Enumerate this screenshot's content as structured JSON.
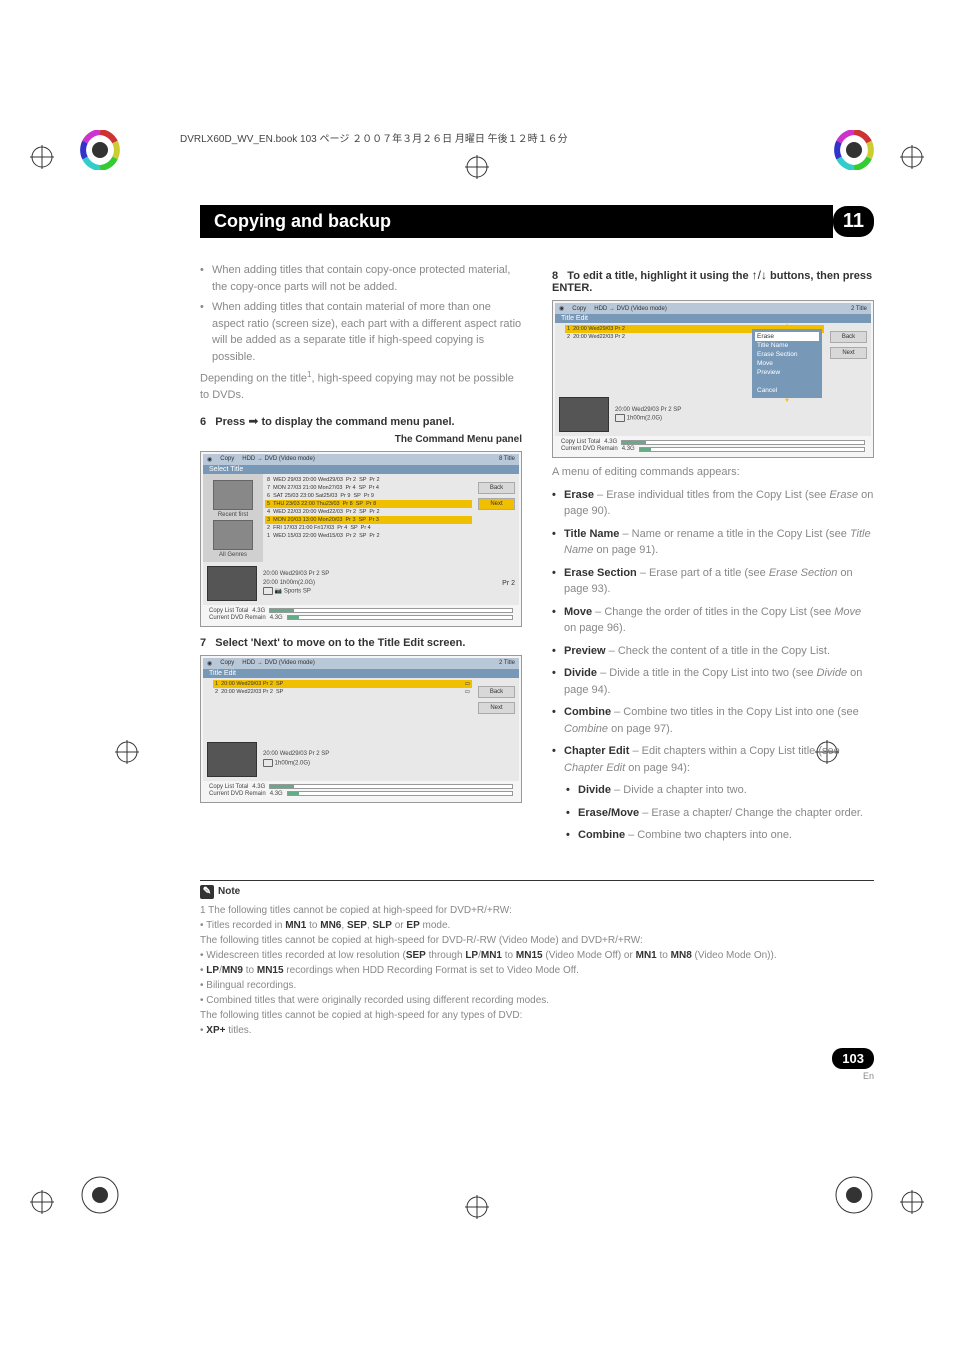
{
  "header_line": "DVRLX60D_WV_EN.book 103 ページ ２００７年３月２６日 月曜日 午後１２時１６分",
  "chapter": {
    "title": "Copying and backup",
    "number": "11"
  },
  "col1": {
    "bullets": [
      "When adding titles that contain copy-once protected material, the copy-once parts will not be added.",
      "When adding titles that contain material of more than one aspect ratio (screen size), each part with a different aspect ratio will be added as a separate title if high-speed copying is possible."
    ],
    "depend_text_a": "Depending on the title",
    "depend_sup": "1",
    "depend_text_b": ", high-speed copying may not be possible to DVDs.",
    "step6": {
      "num": "6",
      "act": "Press ",
      "arrow": "➡",
      "rest": " to display the command menu panel."
    },
    "panel_label": "The Command Menu panel",
    "step7": {
      "num": "7",
      "rest": "Select 'Next' to move on to the Title Edit screen."
    }
  },
  "col2": {
    "step8": {
      "num": "8",
      "rest_a": "To edit a title, highlight it using the ",
      "arrows": "↑/↓",
      "rest_b": " buttons, then press ENTER."
    },
    "menu_intro": "A menu of editing commands appears:",
    "features": [
      {
        "name": "Erase",
        "desc": " – Erase individual titles from the Copy List (see ",
        "ref": "Erase",
        "page": " on page 90)."
      },
      {
        "name": "Title Name",
        "desc": " – Name or rename a title in the Copy List (see ",
        "ref": "Title Name",
        "page": " on page 91)."
      },
      {
        "name": "Erase Section",
        "desc": " – Erase part of a title (see ",
        "ref": "Erase Section",
        "page": " on page 93)."
      },
      {
        "name": "Move",
        "desc": " – Change the order of titles in the Copy List (see ",
        "ref": "Move",
        "page": " on page 96)."
      },
      {
        "name": "Preview",
        "desc": " – Check the content of a title in the Copy List.",
        "ref": "",
        "page": ""
      },
      {
        "name": "Divide",
        "desc": " – Divide a title in the Copy List into two (see ",
        "ref": "Divide",
        "page": " on page 94)."
      },
      {
        "name": "Combine",
        "desc": " – Combine two titles in the Copy List into one (see ",
        "ref": "Combine",
        "page": " on page 97)."
      },
      {
        "name": "Chapter Edit",
        "desc": " – Edit chapters within a Copy List title (see ",
        "ref": "Chapter Edit",
        "page": " on page 94):"
      }
    ],
    "sub_features": [
      {
        "name": "Divide",
        "desc": " – Divide a chapter into two."
      },
      {
        "name": "Erase/Move",
        "desc": " – Erase a chapter/ Change the chapter order."
      },
      {
        "name": "Combine",
        "desc": " – Combine two chapters into one."
      }
    ]
  },
  "screenshots": {
    "common": {
      "copy_label": "Copy",
      "mode_label": "HDD → DVD (Video mode)",
      "back": "Back",
      "next": "Next",
      "copy_list_total": "Copy List Total",
      "current_dvd_remain": "Current DVD Remain",
      "val_43g_a": "4.3G",
      "val_43g_b": "4.3G"
    },
    "ss1": {
      "title_count": "8 Title",
      "tab": "Select Title",
      "left_recent": "Recent first",
      "left_genres": "All Genres",
      "rows": [
        {
          "n": "8",
          "d": "WED 29/03 20:00 Wed29/03",
          "p": "Pr 2",
          "m": "SP",
          "r": "Pr 2"
        },
        {
          "n": "7",
          "d": "MON 27/03 21:00 Mon27/03",
          "p": "Pr 4",
          "m": "SP",
          "r": "Pr 4"
        },
        {
          "n": "6",
          "d": "SAT 25/03 23:00 Sat25/03",
          "p": "Pr 9",
          "m": "SP",
          "r": "Pr 9"
        },
        {
          "n": "5",
          "d": "THU 23/03 22:00 Thu23/03",
          "p": "Pr 8",
          "m": "SP",
          "r": "Pr 8"
        },
        {
          "n": "4",
          "d": "WED 22/03 20:00 Wed22/03",
          "p": "Pr 2",
          "m": "SP",
          "r": "Pr 2"
        },
        {
          "n": "3",
          "d": "MON 20/03 13:00 Mon20/03",
          "p": "Pr 3",
          "m": "SP",
          "r": "Pr 3"
        },
        {
          "n": "2",
          "d": "FRI 17/03 21:00 Fri17/03",
          "p": "Pr 4",
          "m": "SP",
          "r": "Pr 4"
        },
        {
          "n": "1",
          "d": "WED 15/03 22:00 Wed15/03",
          "p": "Pr 2",
          "m": "SP",
          "r": "Pr 2"
        }
      ],
      "preview": {
        "time": "20:00",
        "date": "Wed29/03",
        "pr": "Pr 2",
        "mode": "SP",
        "dur": "1h00m(2.0G)",
        "time2": "20:00",
        "genre": "Sports",
        "mode2": "SP",
        "pr2": "Pr 2"
      }
    },
    "ss2": {
      "title_count": "2 Title",
      "tab": "Title Edit",
      "rows": [
        {
          "n": "1",
          "t": "20:00 Wed29/03 Pr 2",
          "m": "SP"
        },
        {
          "n": "2",
          "t": "20:00 Wed22/03 Pr 2",
          "m": "SP"
        }
      ],
      "preview": {
        "time": "20:00",
        "date": "Wed29/03",
        "pr": "Pr 2",
        "mode": "SP",
        "dur": "1h00m(2.0G)"
      }
    },
    "ss3": {
      "title_count": "2 Title",
      "tab": "Title Edit",
      "rows": [
        {
          "n": "1",
          "t": "20:00 Wed29/03 Pr 2"
        },
        {
          "n": "2",
          "t": "20:00 Wed22/03 Pr 2"
        }
      ],
      "menu": [
        "Erase",
        "Title Name",
        "Erase Section",
        "Move",
        "Preview",
        "",
        "Cancel"
      ],
      "preview": {
        "time": "20:00",
        "date": "Wed29/03",
        "pr": "Pr 2",
        "mode": "SP",
        "dur": "1h00m(2.0G)"
      }
    }
  },
  "note": {
    "label": "Note",
    "lines": [
      {
        "pre": "1 The following titles cannot be copied at high-speed for DVD+R/+RW:"
      },
      {
        "bullet": "Titles recorded in ",
        "b1": "MN1",
        "mid1": " to ",
        "b2": "MN6",
        "mid2": ", ",
        "b3": "SEP",
        "mid3": ", ",
        "b4": "SLP",
        "mid4": " or ",
        "b5": "EP",
        "post": " mode."
      },
      {
        "pre": "The following titles cannot be copied at high-speed for DVD-R/-RW (Video Mode) and DVD+R/+RW:"
      },
      {
        "bullet": "Widescreen titles recorded at low resolution (",
        "b1": "SEP",
        "mid1": " through ",
        "b2": "LP",
        "mid2": "/",
        "b3": "MN1",
        "mid3": " to ",
        "b4": "MN15",
        "mid4": " (Video Mode Off) or ",
        "b5": "MN1",
        "mid5": " to ",
        "b6": "MN8",
        "post": " (Video Mode On))."
      },
      {
        "bullet": "",
        "b1": "LP",
        "mid1": "/",
        "b2": "MN9",
        "mid2": " to ",
        "b3": "MN15",
        "post": " recordings when HDD Recording Format is set to Video Mode Off."
      },
      {
        "bullet": "Bilingual recordings."
      },
      {
        "bullet": "Combined titles that were originally recorded using different recording modes."
      },
      {
        "pre": "The following titles cannot be copied at high-speed for any types of DVD:"
      },
      {
        "bullet": "",
        "b1": "XP+",
        "post": " titles."
      }
    ]
  },
  "page": {
    "num": "103",
    "lang": "En"
  }
}
